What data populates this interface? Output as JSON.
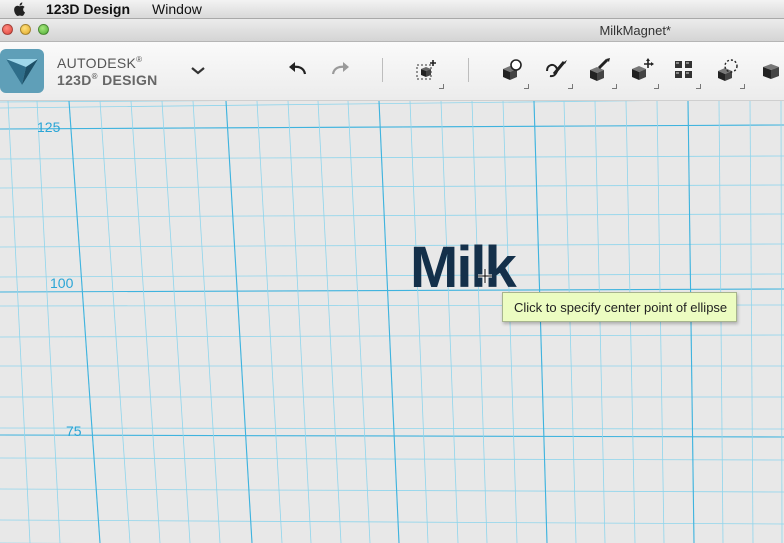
{
  "menubar": {
    "app_name": "123D Design",
    "items": [
      "Window"
    ]
  },
  "window": {
    "title": "MilkMagnet*"
  },
  "brand": {
    "line1": "AUTODESK",
    "line2": "123D",
    "line3": "DESIGN",
    "reg": "®"
  },
  "toolbar": {
    "tools": [
      "undo-icon",
      "redo-icon",
      "primitives-icon",
      "sketch-icon",
      "construct-icon",
      "modify-icon",
      "transform-icon",
      "pattern-icon",
      "grouping-icon",
      "combine-icon"
    ]
  },
  "canvas": {
    "grid_labels": [
      "125",
      "100",
      "75"
    ],
    "model_text": "Milk",
    "tooltip": "Click to specify center point of ellipse"
  },
  "colors": {
    "grid": "#7dd0ea",
    "grid_major": "#3fb3de",
    "model": "#14304a",
    "tooltip_bg": "#ecfcc1"
  }
}
